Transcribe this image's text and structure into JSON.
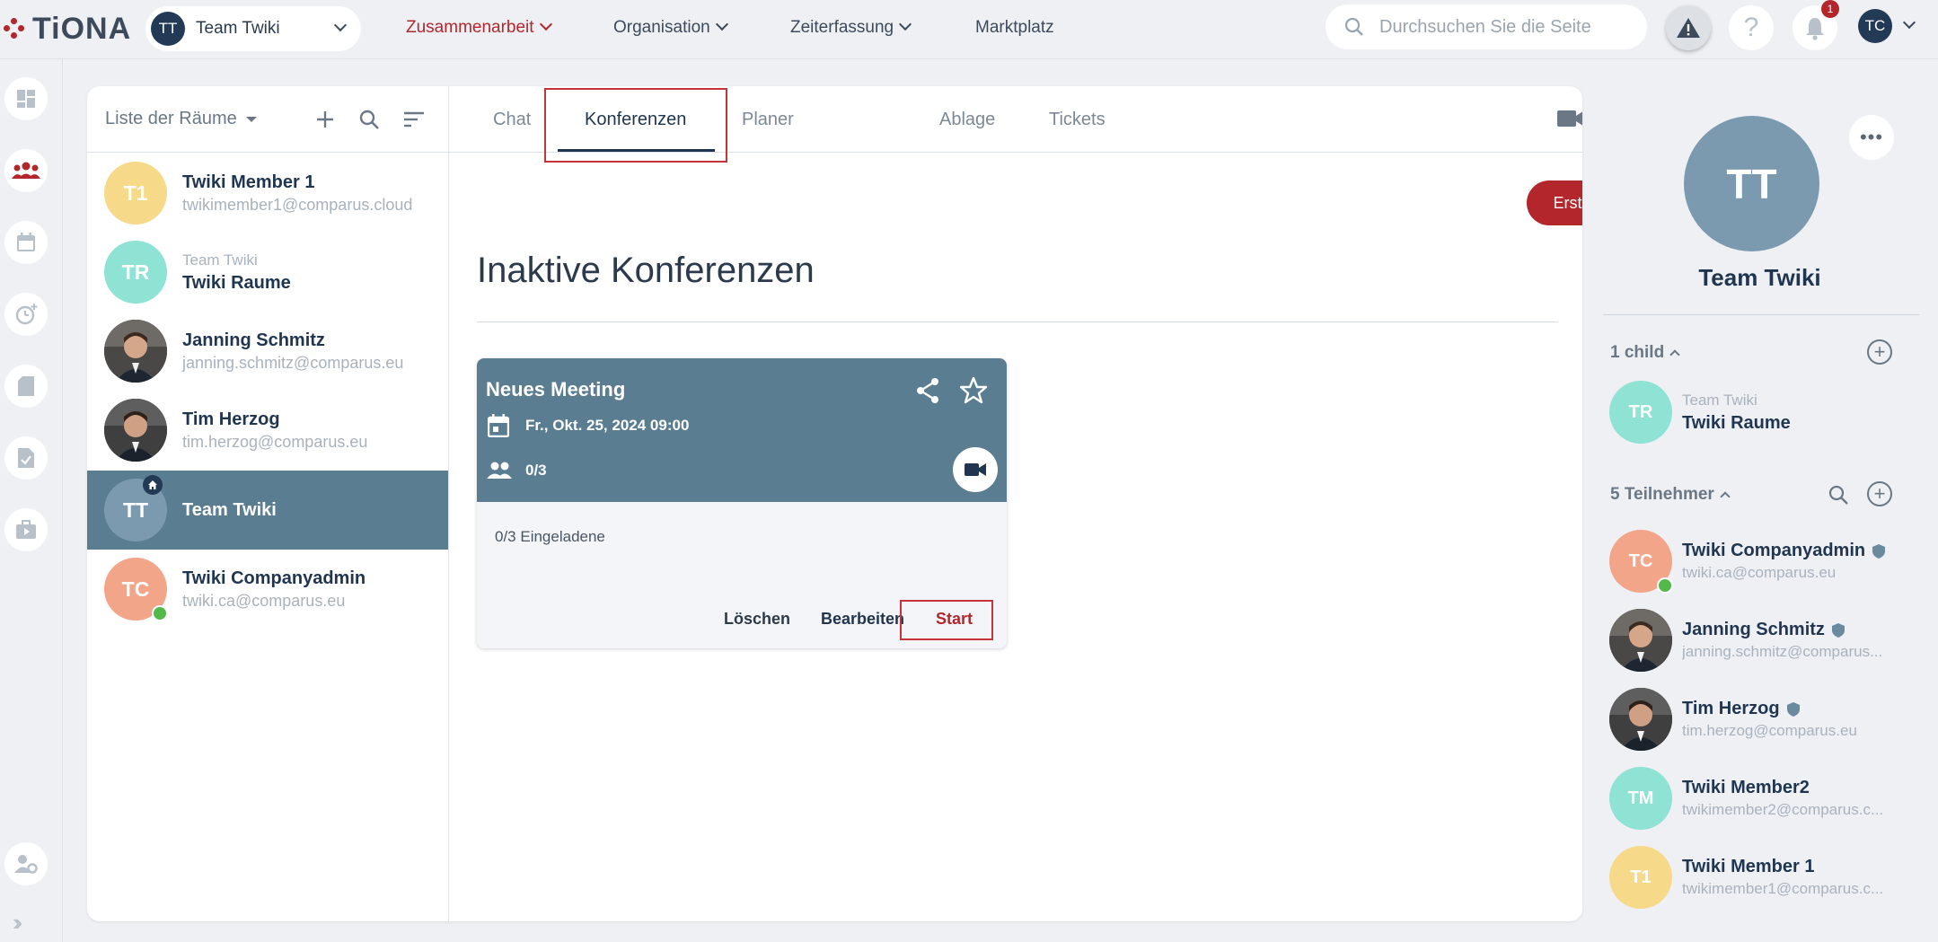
{
  "app": {
    "logo_text": "TiONA"
  },
  "header": {
    "team_initials": "TT",
    "team_name": "Team Twiki",
    "nav": [
      {
        "label": "Zusammenarbeit",
        "active": true
      },
      {
        "label": "Organisation",
        "active": false
      },
      {
        "label": "Zeiterfassung",
        "active": false
      },
      {
        "label": "Marktplatz",
        "active": false
      }
    ],
    "search_placeholder": "Durchsuchen Sie die Seite",
    "notification_count": "1",
    "user_initials": "TC"
  },
  "rooms": {
    "title": "Liste der Räume",
    "items": [
      {
        "initials": "T1",
        "name": "Twiki Member 1",
        "sub": "twikimember1@comparus.cloud",
        "color": "#f7d98a"
      },
      {
        "initials": "TR",
        "pre": "Team Twiki",
        "name": "Twiki Raume",
        "color": "#8ee3d4"
      },
      {
        "initials": "",
        "name": "Janning Schmitz",
        "sub": "janning.schmitz@comparus.eu",
        "photo": true
      },
      {
        "initials": "",
        "name": "Tim Herzog",
        "sub": "tim.herzog@comparus.eu",
        "photo": true
      },
      {
        "initials": "TT",
        "name": "Team Twiki",
        "color": "#7b9ab0",
        "selected": true
      },
      {
        "initials": "TC",
        "name": "Twiki Companyadmin",
        "sub": "twiki.ca@comparus.eu",
        "color": "#f3a58a",
        "online": true
      }
    ]
  },
  "tabs": [
    "Chat",
    "Konferenzen",
    "Planer",
    "Ablage",
    "Tickets"
  ],
  "conferences": {
    "create_label": "Erstellen",
    "section_title": "Inaktive Konferenzen",
    "meeting": {
      "title": "Neues Meeting",
      "date": "Fr., Okt. 25, 2024 09:00",
      "participants": "0/3",
      "invited": "0/3 Eingeladene",
      "delete_label": "Löschen",
      "edit_label": "Bearbeiten",
      "start_label": "Start"
    }
  },
  "panel": {
    "initials": "TT",
    "title": "Team Twiki",
    "child_label": "1 child",
    "child": {
      "initials": "TR",
      "pre": "Team Twiki",
      "name": "Twiki Raume",
      "color": "#8ee3d4"
    },
    "members_label": "5 Teilnehmer",
    "members": [
      {
        "initials": "TC",
        "name": "Twiki Companyadmin",
        "sub": "twiki.ca@comparus.eu",
        "color": "#f3a58a",
        "online": true,
        "admin": true
      },
      {
        "initials": "",
        "name": "Janning Schmitz",
        "sub": "janning.schmitz@comparus...",
        "photo": true,
        "admin": true
      },
      {
        "initials": "",
        "name": "Tim Herzog",
        "sub": "tim.herzog@comparus.eu",
        "photo": true,
        "admin": true
      },
      {
        "initials": "TM",
        "name": "Twiki Member2",
        "sub": "twikimember2@comparus.c...",
        "color": "#8ee3d4"
      },
      {
        "initials": "T1",
        "name": "Twiki Member 1",
        "sub": "twikimember1@comparus.c...",
        "color": "#f7d98a"
      }
    ]
  },
  "colors": {
    "brand_red": "#b3262c",
    "navy": "#1f3550",
    "slate": "#5a7d92"
  }
}
